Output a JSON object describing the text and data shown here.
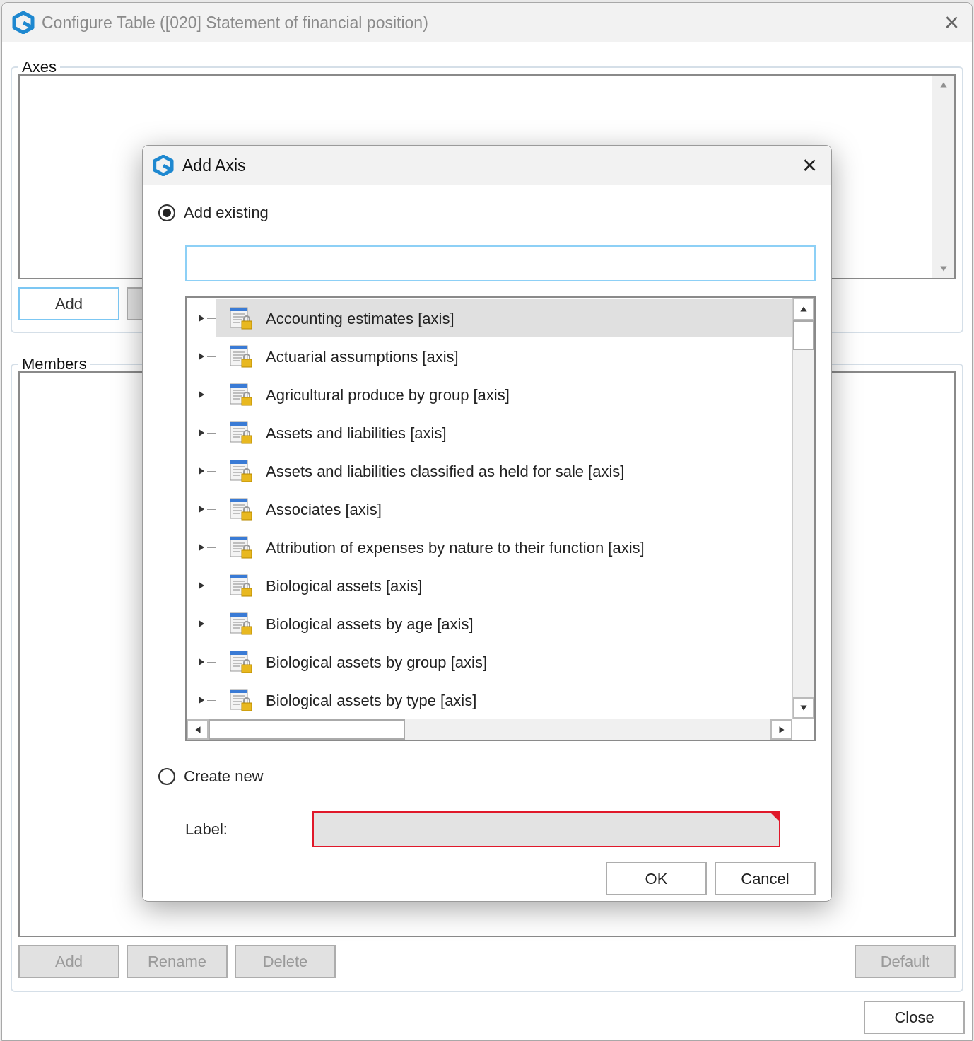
{
  "window": {
    "title": "Configure Table ([020] Statement of financial position)",
    "close": "×"
  },
  "axes_group": {
    "label": "Axes",
    "buttons": [
      {
        "label": "Add",
        "focused": true,
        "disabled": false
      },
      {
        "focused": false,
        "disabled": true
      }
    ]
  },
  "members_group": {
    "label": "Members",
    "buttons": [
      {
        "label": "Add",
        "disabled": true
      },
      {
        "label": "Rename",
        "disabled": true
      },
      {
        "label": "Delete",
        "disabled": true
      }
    ],
    "default_button": {
      "label": "Default",
      "disabled": true
    }
  },
  "close_button": "Close",
  "dialog": {
    "title": "Add Axis",
    "options": [
      {
        "label": "Add existing",
        "selected": true
      },
      {
        "label": "Create new",
        "selected": false
      }
    ],
    "tree": [
      {
        "label": "Accounting estimates [axis]",
        "selected": true,
        "expanded": false
      },
      {
        "label": "Actuarial assumptions [axis]",
        "selected": false,
        "expanded": false
      },
      {
        "label": "Agricultural produce by group [axis]",
        "selected": false,
        "expanded": false
      },
      {
        "label": "Assets and liabilities [axis]",
        "selected": false,
        "expanded": false
      },
      {
        "label": "Assets and liabilities classified as held for sale [axis]",
        "selected": false,
        "expanded": false
      },
      {
        "label": "Associates [axis]",
        "selected": false,
        "expanded": false
      },
      {
        "label": "Attribution of expenses by nature to their function [axis]",
        "selected": false,
        "expanded": false
      },
      {
        "label": "Biological assets [axis]",
        "selected": false,
        "expanded": false
      },
      {
        "label": "Biological assets by age [axis]",
        "selected": false,
        "expanded": false
      },
      {
        "label": "Biological assets by group [axis]",
        "selected": false,
        "expanded": false
      },
      {
        "label": "Biological assets by type [axis]",
        "selected": false,
        "expanded": false
      }
    ],
    "label_field": {
      "label": "Label:",
      "invalid": true
    },
    "buttons": [
      "OK",
      "Cancel"
    ]
  }
}
